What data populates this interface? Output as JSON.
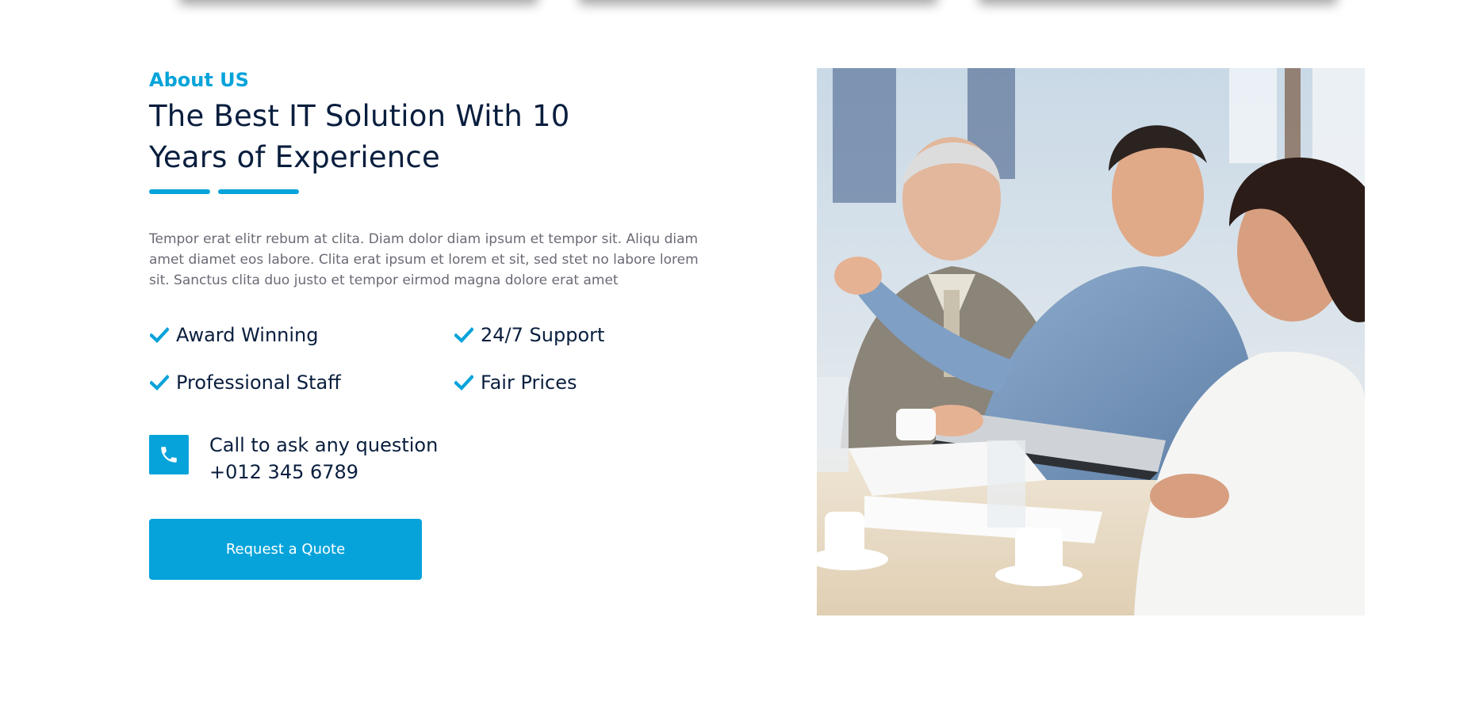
{
  "about": {
    "eyebrow": "About US",
    "heading": "The Best IT Solution With 10 Years of Experience",
    "lead": "Tempor erat elitr rebum at clita. Diam dolor diam ipsum et tempor sit. Aliqu diam amet diamet eos labore. Clita erat ipsum et lorem et sit, sed stet no labore lorem sit. Sanctus clita duo justo et tempor eirmod magna dolore erat amet",
    "features": [
      {
        "label": "Award Winning",
        "icon": "check-icon"
      },
      {
        "label": "24/7 Support",
        "icon": "check-icon"
      },
      {
        "label": "Professional Staff",
        "icon": "check-icon"
      },
      {
        "label": "Fair Prices",
        "icon": "check-icon"
      }
    ],
    "call": {
      "question": "Call to ask any question",
      "number": "+012 345 6789",
      "icon": "phone-icon"
    },
    "cta_label": "Request a Quote"
  },
  "colors": {
    "accent": "#06A3DA",
    "heading": "#091E3E",
    "body_text": "#6B6A75"
  }
}
